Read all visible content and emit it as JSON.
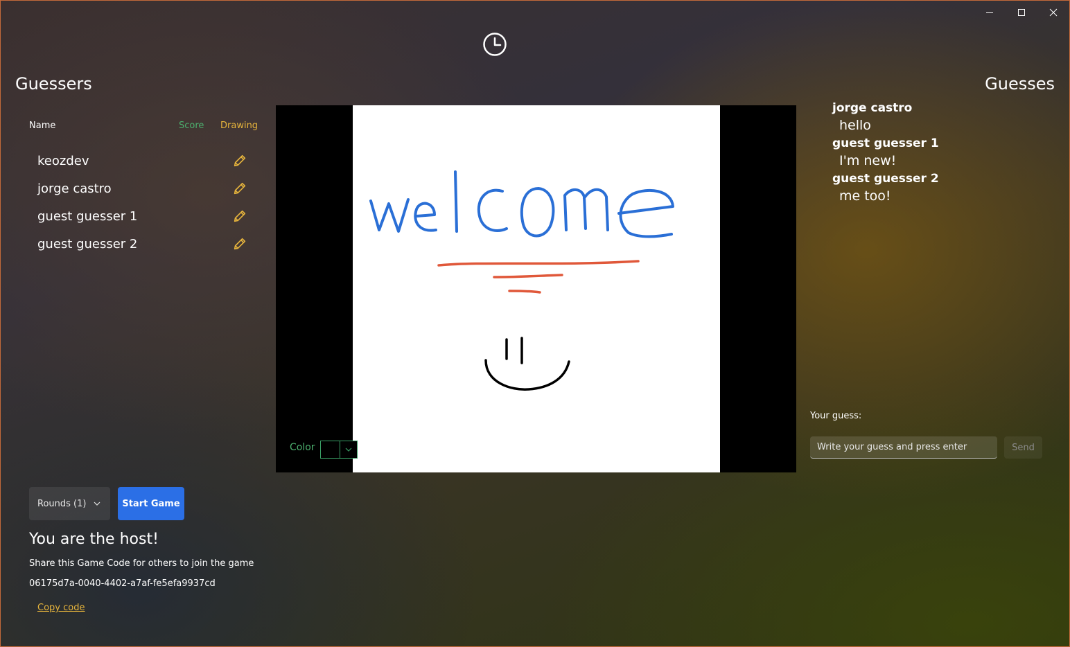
{
  "window": {
    "controls": [
      "minimize-icon",
      "maximize-icon",
      "close-icon"
    ]
  },
  "timer": {
    "icon": "clock-icon"
  },
  "guessers_panel": {
    "title": "Guessers",
    "columns": {
      "name": "Name",
      "score": "Score",
      "drawing": "Drawing"
    },
    "players": [
      {
        "name": "keozdev",
        "drawing_icon": "pencil-icon"
      },
      {
        "name": "jorge castro",
        "drawing_icon": "pencil-icon"
      },
      {
        "name": "guest guesser 1",
        "drawing_icon": "pencil-icon"
      },
      {
        "name": "guest guesser 2",
        "drawing_icon": "pencil-icon"
      }
    ]
  },
  "canvas": {
    "color_label": "Color",
    "selected_color": "#000000"
  },
  "guesses_panel": {
    "title": "Guesses",
    "messages": [
      {
        "user": "jorge castro",
        "text": "hello"
      },
      {
        "user": "guest guesser 1",
        "text": "I'm new!"
      },
      {
        "user": "guest guesser 2",
        "text": "me too!"
      }
    ],
    "your_guess_label": "Your guess:",
    "input_placeholder": "Write your guess and press enter",
    "input_value": "",
    "send_label": "Send"
  },
  "host_panel": {
    "rounds_label": "Rounds (1)",
    "start_label": "Start Game",
    "host_title": "You are the host!",
    "share_text": "Share this Game Code for others to join the game",
    "game_code": "06175d7a-0040-4402-a7af-fe5efa9937cd",
    "copy_label": "Copy code"
  },
  "colors": {
    "accent_blue": "#2b6fe6",
    "score_green": "#4caf6e",
    "drawing_gold": "#e6b43c",
    "ink_blue": "#2a6fd6",
    "ink_red": "#e0583a",
    "ink_black": "#000000"
  }
}
